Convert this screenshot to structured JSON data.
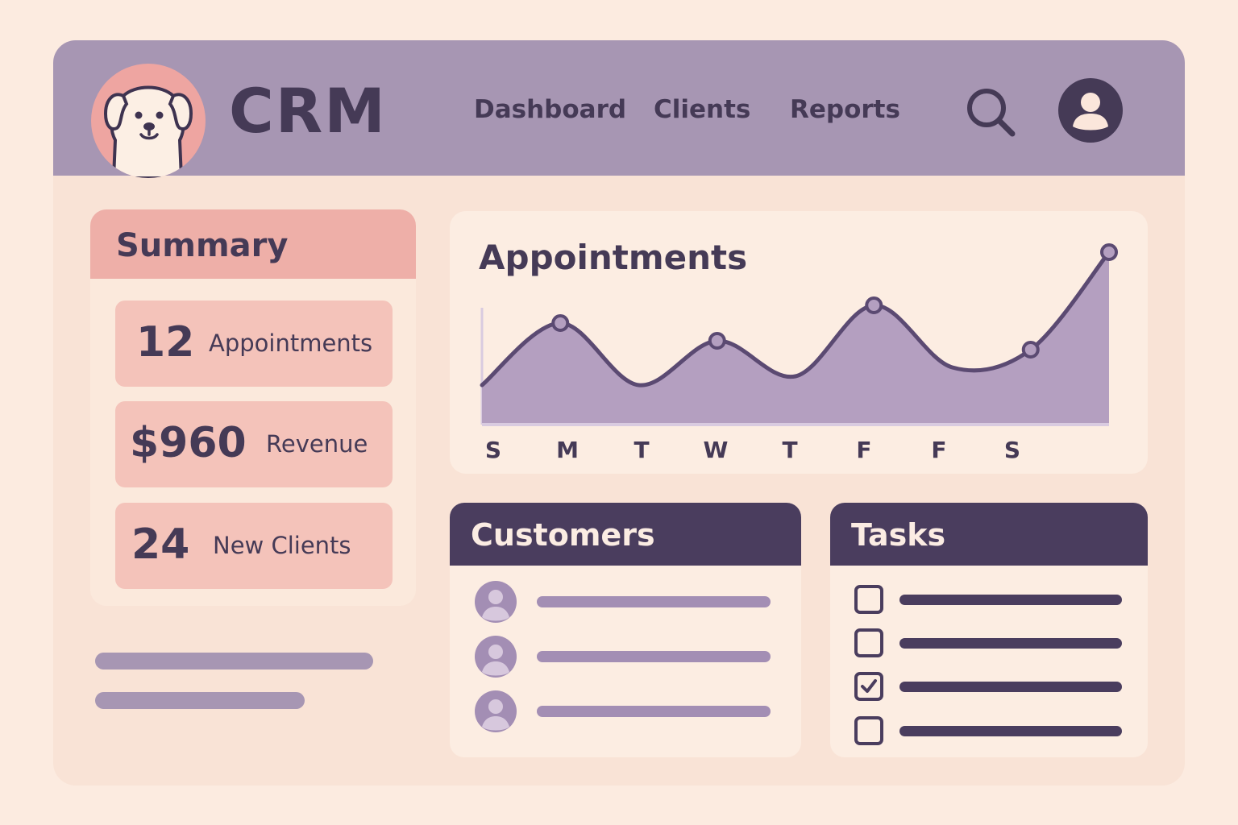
{
  "app": {
    "title": "CRM",
    "logo_icon": "dog-icon"
  },
  "nav": {
    "items": [
      {
        "label": "Dashboard"
      },
      {
        "label": "Clients"
      },
      {
        "label": "Reports"
      }
    ],
    "search_icon": "search-icon",
    "profile_icon": "user-avatar-icon"
  },
  "summary": {
    "title": "Summary",
    "stats": [
      {
        "value": "12",
        "label": "Appointments"
      },
      {
        "value": "$960",
        "label": "Revenue"
      },
      {
        "value": "24",
        "label": "New Clients"
      }
    ]
  },
  "chart_data": {
    "type": "area",
    "title": "Appointments",
    "x": [
      "S",
      "M",
      "T",
      "W",
      "T",
      "F",
      "F",
      "S"
    ],
    "xlabel": "",
    "ylabel": "",
    "series": [
      {
        "values": [
          2,
          5.5,
          2,
          4.5,
          2.5,
          6.5,
          3,
          4,
          9.5
        ]
      }
    ],
    "point_indices_marked": [
      1,
      3,
      5,
      7,
      8
    ],
    "ylim": [
      0,
      10
    ],
    "grid": false,
    "colors": {
      "line": "#5b4a72",
      "fill": "#b49fc0"
    }
  },
  "customers": {
    "title": "Customers",
    "rows": [
      {
        "avatar_icon": "user-avatar-icon"
      },
      {
        "avatar_icon": "user-avatar-icon"
      },
      {
        "avatar_icon": "user-avatar-icon"
      }
    ]
  },
  "tasks": {
    "title": "Tasks",
    "items": [
      {
        "checked": false
      },
      {
        "checked": false
      },
      {
        "checked": true
      },
      {
        "checked": false
      }
    ]
  },
  "colors": {
    "background": "#fcebe0",
    "header": "#a796b3",
    "accent_pink": "#eeafa8",
    "dark": "#453a56"
  }
}
